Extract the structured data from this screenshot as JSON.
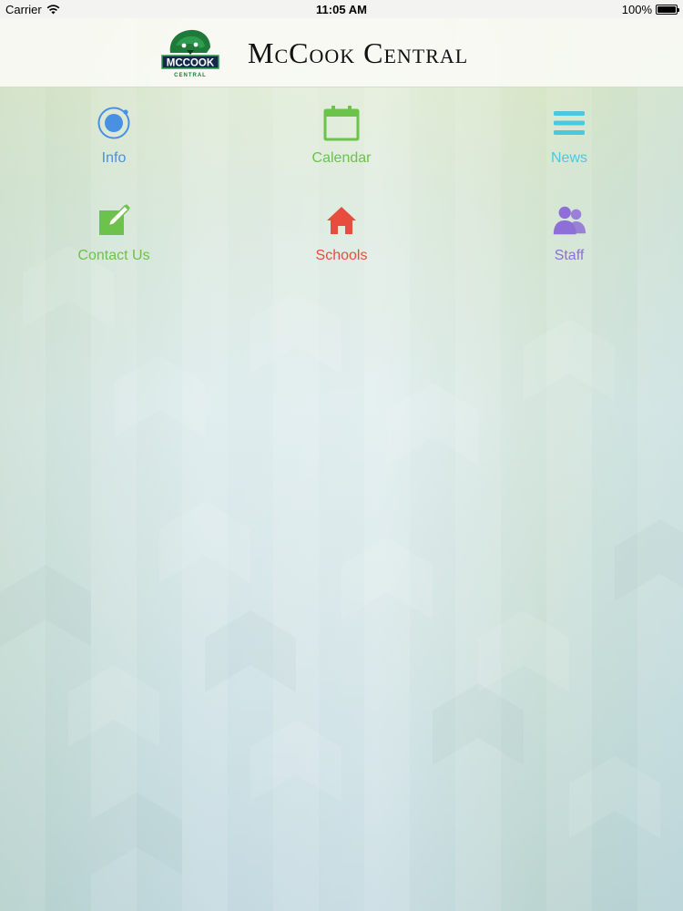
{
  "status_bar": {
    "carrier": "Carrier",
    "time": "11:05 AM",
    "battery": "100%"
  },
  "header": {
    "logo_text": "MCCOOK",
    "logo_subtext": "CENTRAL",
    "title": "McCook Central"
  },
  "menu": [
    {
      "label": "Info",
      "icon": "info-circle-icon",
      "color": "#4a90e2"
    },
    {
      "label": "Calendar",
      "icon": "calendar-icon",
      "color": "#6cc24a"
    },
    {
      "label": "News",
      "icon": "list-icon",
      "color": "#4bc8de"
    },
    {
      "label": "Contact Us",
      "icon": "edit-icon",
      "color": "#6cc24a"
    },
    {
      "label": "Schools",
      "icon": "home-icon",
      "color": "#e84c3d"
    },
    {
      "label": "Staff",
      "icon": "users-icon",
      "color": "#8e6fd8"
    }
  ],
  "colors": {
    "logo_green": "#1f7a3a",
    "logo_panel": "#13294b"
  }
}
